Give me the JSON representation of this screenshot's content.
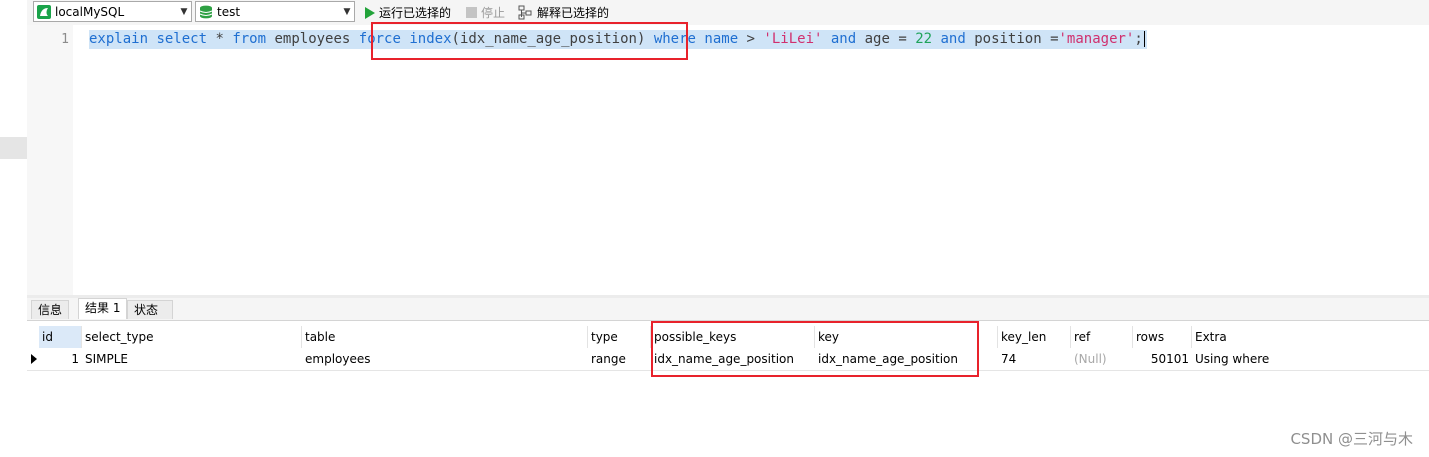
{
  "toolbar": {
    "connection": "localMySQL",
    "database": "test",
    "run_label": "运行已选择的",
    "stop_label": "停止",
    "explain_label": "解释已选择的",
    "connection_icon": "mysql-connection-icon",
    "database_icon": "database-icon",
    "run_icon": "play-icon",
    "stop_icon": "stop-icon",
    "explain_icon": "explain-icon"
  },
  "editor": {
    "line_number": "1",
    "tokens": [
      {
        "t": "explain",
        "c": "kw"
      },
      {
        "t": " ",
        "c": "tx"
      },
      {
        "t": "select",
        "c": "kw"
      },
      {
        "t": " * ",
        "c": "tx"
      },
      {
        "t": "from",
        "c": "kw"
      },
      {
        "t": " employees ",
        "c": "tx"
      },
      {
        "t": "force",
        "c": "kw"
      },
      {
        "t": " ",
        "c": "tx"
      },
      {
        "t": "index",
        "c": "kw"
      },
      {
        "t": "(idx_name_age_position) ",
        "c": "tx"
      },
      {
        "t": "where",
        "c": "kw"
      },
      {
        "t": " ",
        "c": "tx"
      },
      {
        "t": "name",
        "c": "kw"
      },
      {
        "t": " > ",
        "c": "tx"
      },
      {
        "t": "'LiLei'",
        "c": "str"
      },
      {
        "t": " ",
        "c": "tx"
      },
      {
        "t": "and",
        "c": "kw"
      },
      {
        "t": " age = ",
        "c": "tx"
      },
      {
        "t": "22",
        "c": "num"
      },
      {
        "t": " ",
        "c": "tx"
      },
      {
        "t": "and",
        "c": "kw"
      },
      {
        "t": " position =",
        "c": "tx"
      },
      {
        "t": "'manager'",
        "c": "str"
      },
      {
        "t": ";",
        "c": "tx"
      }
    ]
  },
  "tabs": [
    {
      "label": "信息",
      "active": false
    },
    {
      "label": "结果 1",
      "active": true
    },
    {
      "label": "状态",
      "active": false
    }
  ],
  "result": {
    "columns": [
      "id",
      "select_type",
      "table",
      "type",
      "possible_keys",
      "key",
      "key_len",
      "ref",
      "rows",
      "Extra"
    ],
    "rows": [
      [
        "1",
        "SIMPLE",
        "employees",
        "range",
        "idx_name_age_position",
        "idx_name_age_position",
        "74",
        "(Null)",
        "50101",
        "Using where"
      ]
    ]
  },
  "highlight_color": "#e8222b",
  "selection_color": "#cfe4f7",
  "watermark": "CSDN @三河与木"
}
